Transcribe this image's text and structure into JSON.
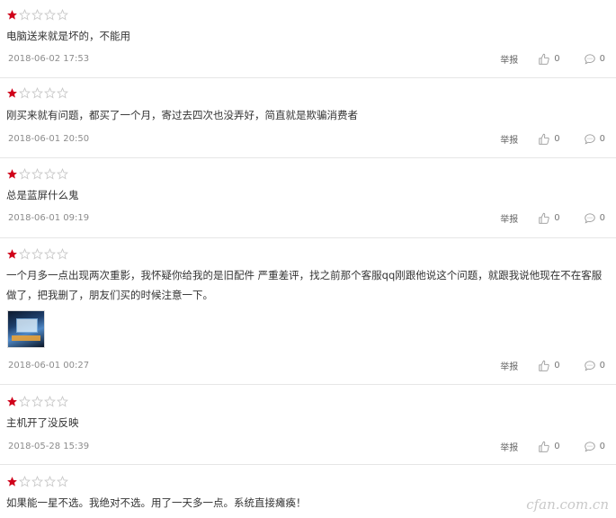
{
  "reviews": [
    {
      "rating": 1,
      "text": "电脑送来就是坏的，不能用",
      "date": "2018-06-02 17:53",
      "report": "举报",
      "likes": "0",
      "comments": "0"
    },
    {
      "rating": 1,
      "text": "刚买来就有问题，都买了一个月，寄过去四次也没弄好，简直就是欺骗消费者",
      "date": "2018-06-01 20:50",
      "report": "举报",
      "likes": "0",
      "comments": "0"
    },
    {
      "rating": 1,
      "text": "总是蓝屏什么鬼",
      "date": "2018-06-01 09:19",
      "report": "举报",
      "likes": "0",
      "comments": "0"
    },
    {
      "rating": 1,
      "text": "一个月多一点出现两次重影，我怀疑你给我的是旧配件 严重差评，找之前那个客服qq刚跟他说这个问题，就跟我说他现在不在客服做了，把我删了，朋友们买的时候注意一下。",
      "date": "2018-06-01 00:27",
      "report": "举报",
      "likes": "0",
      "comments": "0"
    },
    {
      "rating": 1,
      "text": "主机开了没反映",
      "date": "2018-05-28 15:39",
      "report": "举报",
      "likes": "0",
      "comments": "0"
    },
    {
      "rating": 1,
      "text": "如果能一星不选。我绝对不选。用了一天多一点。系统直接瘫痪！",
      "date": "",
      "report": "",
      "likes": "",
      "comments": ""
    }
  ],
  "watermark": "cfan.com.cn",
  "colors": {
    "star_filled": "#d0021b",
    "star_empty": "#c8c8c8",
    "divider": "#e6e6e6"
  }
}
